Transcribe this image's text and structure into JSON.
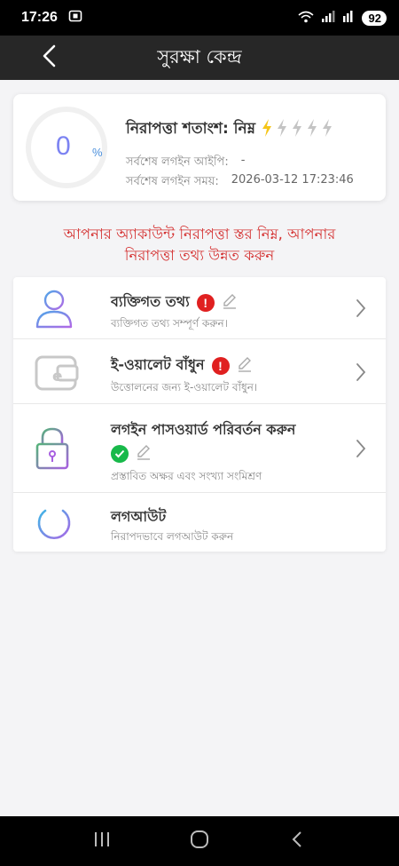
{
  "status_bar": {
    "time": "17:26",
    "battery": "92"
  },
  "header": {
    "title": "সুরক্ষা কেন্দ্র",
    "back_icon": "chevron-left-icon"
  },
  "score": {
    "value": "0",
    "percent_sign": "%",
    "title": "নিরাপত্তা শতাংশ: নিম্ন",
    "bolts_active": 1,
    "bolts_total": 5,
    "last_ip_label": "সর্বশেষ লগইন আইপি:",
    "last_ip_value": "-",
    "last_time_label": "সর্বশেষ লগইন সময়:",
    "last_time_value": "2026-03-12 17:23:46"
  },
  "warning": {
    "line1": "আপনার অ্যাকাউন্ট নিরাপত্তা স্তর নিম্ন, আপনার",
    "line2": "নিরাপত্তা তথ্য উন্নত করুন"
  },
  "items": [
    {
      "title": "ব্যক্তিগত তথ্য",
      "subtitle": "ব্যক্তিগত তথ্য সম্পূর্ণ করুন।",
      "status": "incomplete",
      "icon": "user-icon"
    },
    {
      "title": "ই-ওয়ালেট বাঁধুন",
      "subtitle": "উত্তোলনের জন্য ই-ওয়ালেট বাঁধুন।",
      "status": "incomplete",
      "icon": "wallet-icon"
    },
    {
      "title": "লগইন পাসওয়ার্ড পরিবর্তন করুন",
      "subtitle": "প্রস্তাবিত অক্ষর এবং সংখ্যা সংমিশ্রণ",
      "status": "complete",
      "icon": "lock-icon"
    },
    {
      "title": "লগআউট",
      "subtitle": "নিরাপদভাবে লগআউট করুন",
      "icon": "power-icon"
    }
  ],
  "colors": {
    "header_bg": "#272727",
    "warning_text": "#d42f2f",
    "bolt_active": "#f5c518",
    "bolt_inactive": "#c4c4c4",
    "alert_red": "#e02020",
    "ok_green": "#18b94a"
  }
}
